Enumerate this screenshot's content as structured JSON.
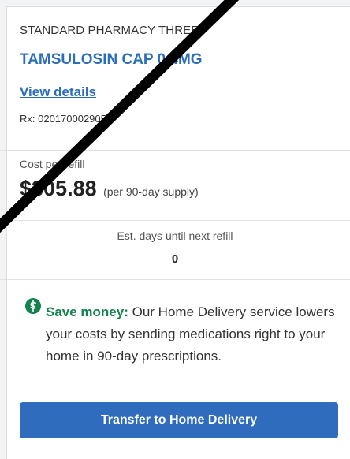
{
  "prescription": {
    "pharmacy_name": "STANDARD PHARMACY THREE",
    "drug_name": "TAMSULOSIN CAP 0.4MG",
    "view_details_label": "View details",
    "rx_number": "Rx: 020170002905"
  },
  "cost": {
    "label": "Cost per refill",
    "value": "$305.88",
    "supply_note": "(per 90-day supply)"
  },
  "refill": {
    "label": "Est. days until next refill",
    "days": "0"
  },
  "promo": {
    "strong": "Save money:",
    "text": " Our Home Delivery service lowers your costs by sending medications right to your home in 90-day prescriptions."
  },
  "actions": {
    "transfer_label": "Transfer to Home Delivery"
  },
  "icons": {
    "save_money": "dollar-circle-icon"
  },
  "colors": {
    "link_blue": "#2a6ebb",
    "button_blue": "#2f6cbd",
    "save_green": "#14814f",
    "slash_black": "#000000"
  }
}
